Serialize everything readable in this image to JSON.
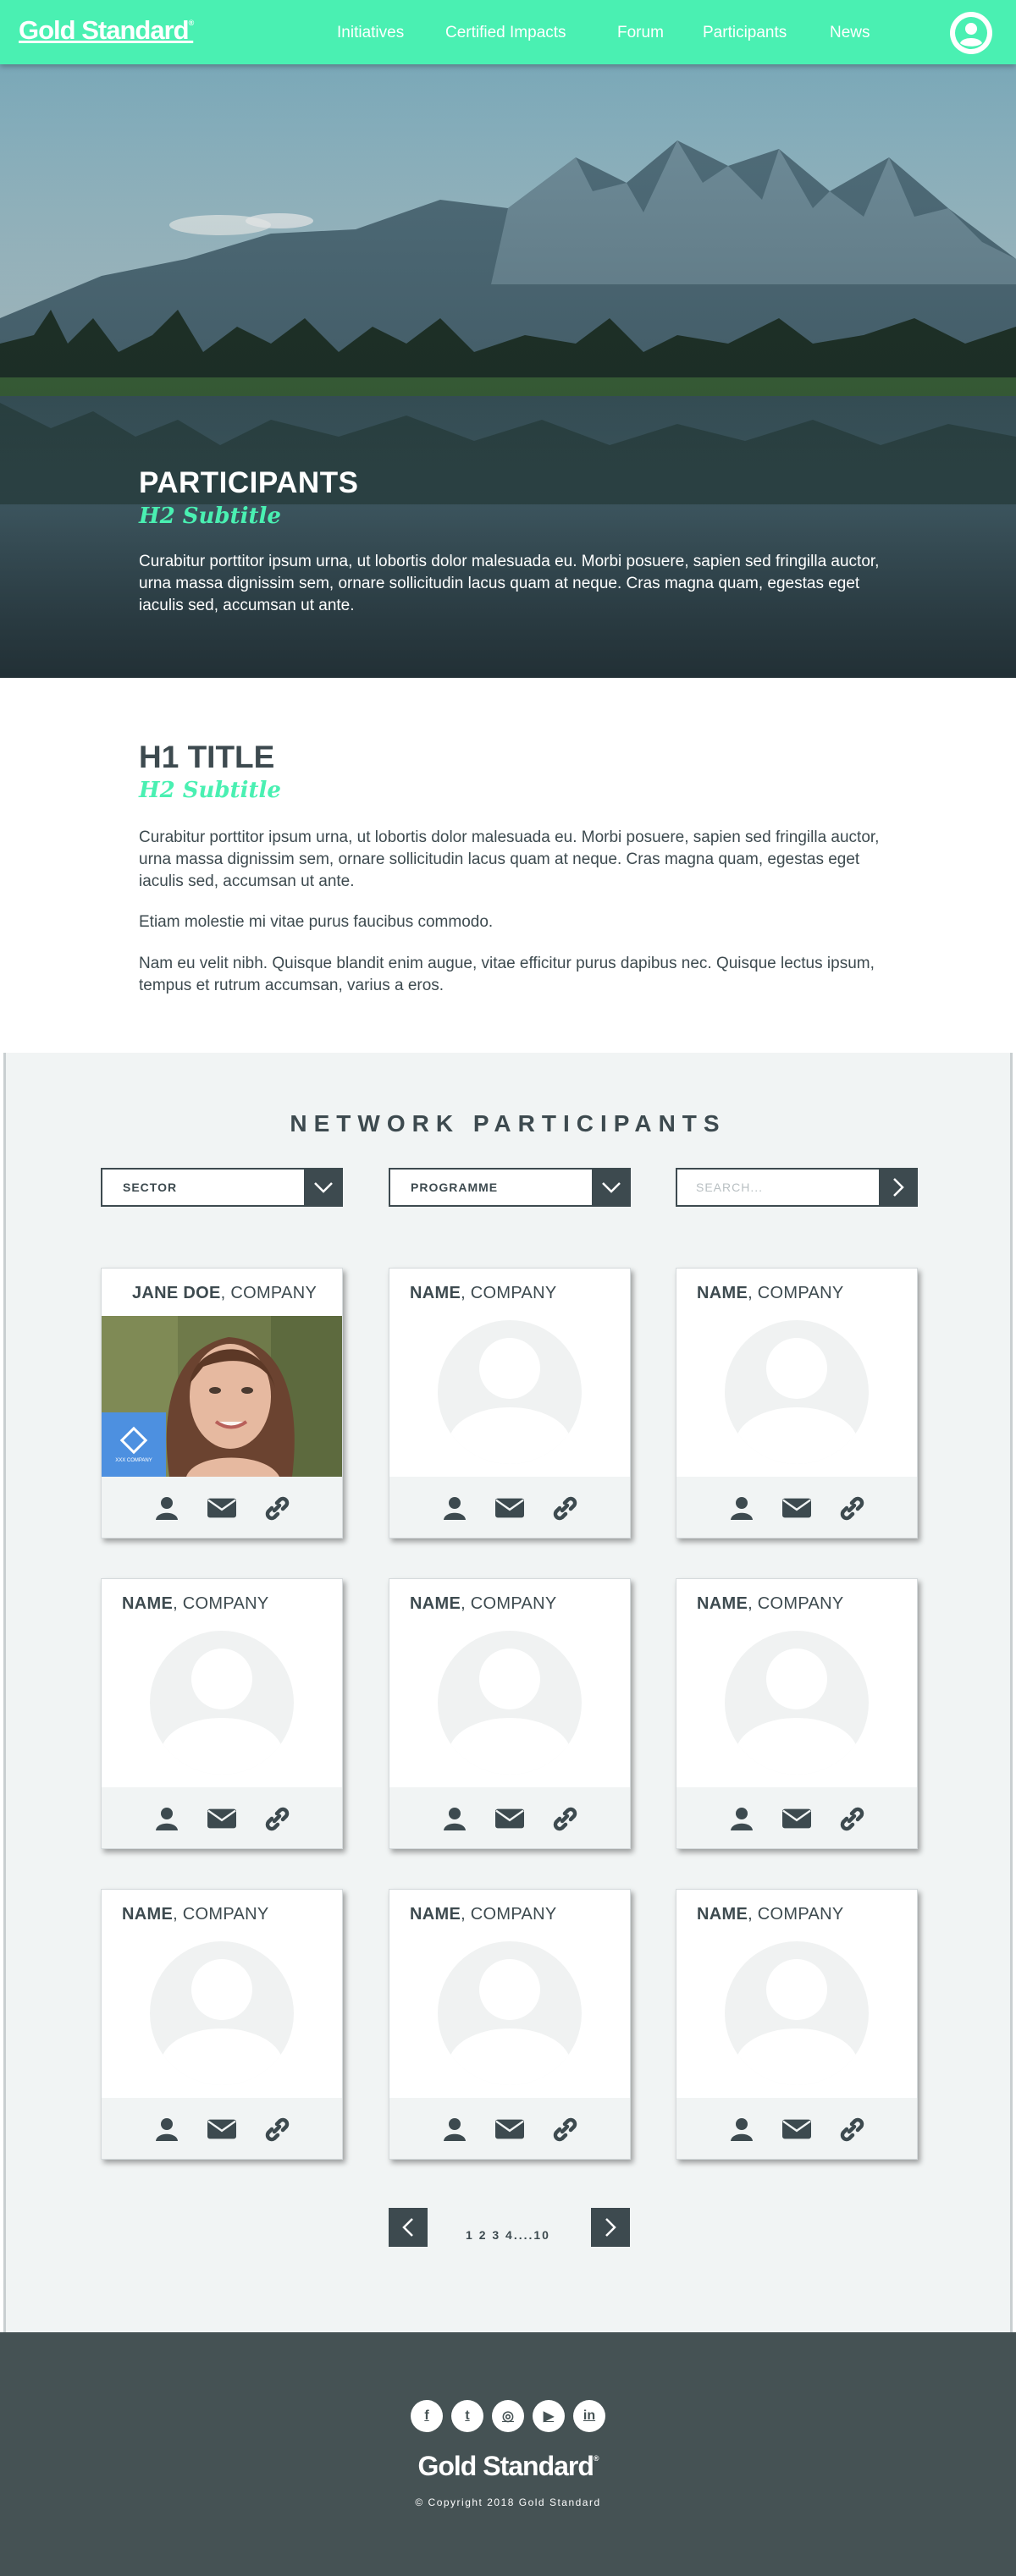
{
  "brand": {
    "logo_text": "Gold Standard",
    "logo_mark": "®",
    "accent_color": "#4af0b2",
    "dark_color": "#3d4a4f"
  },
  "nav": {
    "items": [
      {
        "label": "Initiatives"
      },
      {
        "label": "Certified Impacts"
      },
      {
        "label": "Forum"
      },
      {
        "label": "Participants"
      },
      {
        "label": "News"
      }
    ],
    "account_icon": "user-icon"
  },
  "hero": {
    "title": "PARTICIPANTS",
    "subtitle": "H2 Subtitle",
    "body": "Curabitur porttitor ipsum urna, ut lobortis dolor malesuada eu. Morbi posuere, sapien sed fringilla auctor, urna massa dignissim sem, ornare sollicitudin lacus quam at neque. Cras magna quam, egestas eget iaculis sed, accumsan ut ante."
  },
  "intro": {
    "title": "H1 TITLE",
    "subtitle": "H2 Subtitle",
    "paragraphs": [
      "Curabitur porttitor ipsum urna, ut lobortis dolor malesuada eu. Morbi posuere, sapien sed fringilla auctor, urna massa dignissim sem, ornare sollicitudin lacus quam at neque. Cras magna quam, egestas eget iaculis sed, accumsan ut ante.",
      "Etiam molestie mi vitae purus faucibus commodo.",
      "Nam eu velit nibh. Quisque blandit enim augue, vitae efficitur purus dapibus nec. Quisque lectus ipsum, tempus et rutrum accumsan, varius a eros."
    ]
  },
  "participants": {
    "section_title": "NETWORK PARTICIPANTS",
    "filters": {
      "sector_label": "SECTOR",
      "programme_label": "PROGRAMME",
      "search_placeholder": "SEARCH..."
    },
    "cards": [
      {
        "name": "JANE DOE",
        "company": ", COMPANY",
        "has_photo": true,
        "badge_text": "XXX COMPANY"
      },
      {
        "name": "NAME",
        "company": ", COMPANY",
        "has_photo": false
      },
      {
        "name": "NAME",
        "company": ", COMPANY",
        "has_photo": false
      },
      {
        "name": "NAME",
        "company": ", COMPANY",
        "has_photo": false
      },
      {
        "name": "NAME",
        "company": ", COMPANY",
        "has_photo": false
      },
      {
        "name": "NAME",
        "company": ", COMPANY",
        "has_photo": false
      },
      {
        "name": "NAME",
        "company": ", COMPANY",
        "has_photo": false
      },
      {
        "name": "NAME",
        "company": ", COMPANY",
        "has_photo": false
      },
      {
        "name": "NAME",
        "company": ", COMPANY",
        "has_photo": false
      }
    ],
    "card_actions": [
      "profile-icon",
      "mail-icon",
      "link-icon"
    ],
    "pagination": {
      "pages_label": "1 2 3 4....10",
      "prev_icon": "chevron-left-icon",
      "next_icon": "chevron-right-icon"
    }
  },
  "footer": {
    "social": [
      {
        "icon": "facebook-icon",
        "glyph": "f"
      },
      {
        "icon": "twitter-icon",
        "glyph": "t"
      },
      {
        "icon": "instagram-icon",
        "glyph": "◎"
      },
      {
        "icon": "youtube-icon",
        "glyph": "▶"
      },
      {
        "icon": "linkedin-icon",
        "glyph": "in"
      }
    ],
    "logo_text": "Gold Standard",
    "logo_mark": "®",
    "copyright": "© Copyright 2018 Gold Standard"
  }
}
